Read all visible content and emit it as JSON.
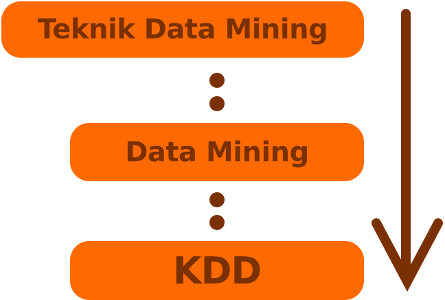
{
  "boxes": {
    "top": "Teknik Data Mining",
    "middle": "Data Mining",
    "bottom": "KDD"
  },
  "colors": {
    "box_fill": "#ff6a00",
    "text": "#7a3000",
    "dots": "#7a3000",
    "arrow": "#7a3000"
  }
}
